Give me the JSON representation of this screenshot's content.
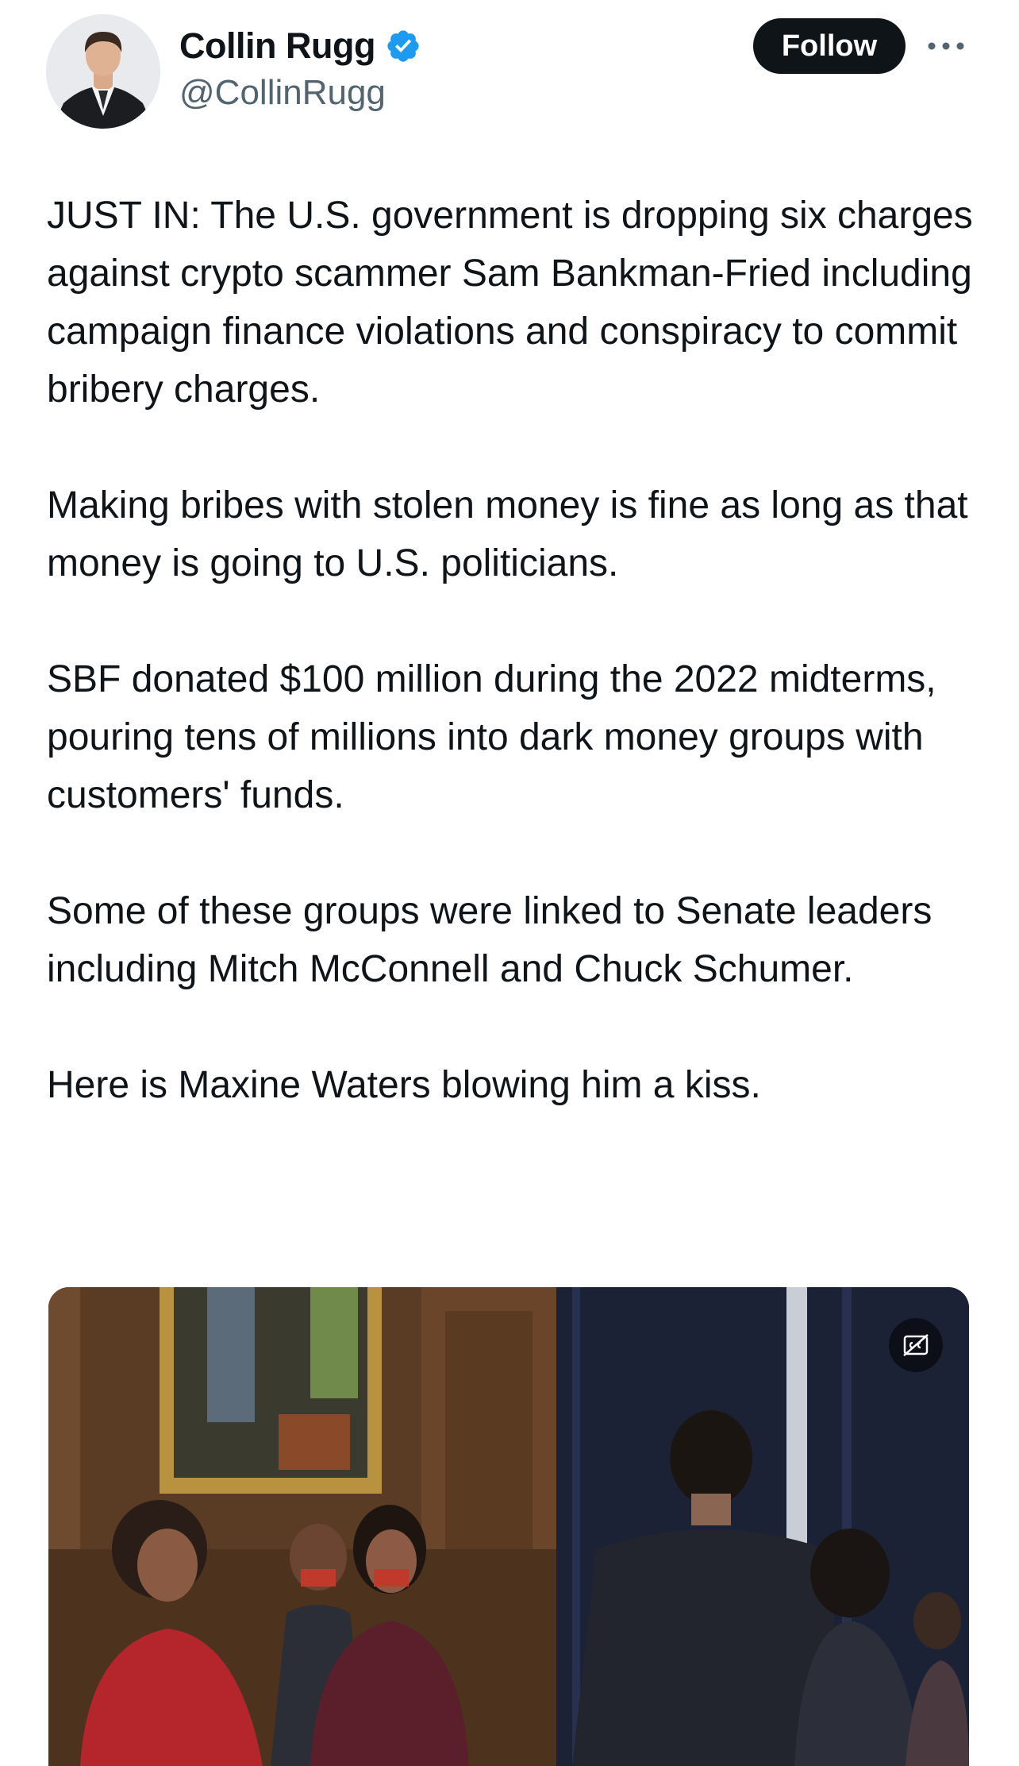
{
  "author": {
    "display_name": "Collin Rugg",
    "handle": "@CollinRugg",
    "verified": true,
    "avatar_icon": "profile-photo"
  },
  "actions": {
    "follow_label": "Follow",
    "more_icon": "more-horizontal-icon"
  },
  "tweet": {
    "paragraphs": [
      "JUST IN: The U.S. government is dropping six charges against crypto scammer Sam Bankman-Fried including campaign finance violations and conspiracy to commit bribery charges.",
      "Making bribes with stolen money is fine as long as that money is going to U.S. politicians.",
      "SBF donated $100 million during the 2022 midterms, pouring tens of millions into dark money groups with customers' funds.",
      "Some of these groups were linked to Senate leaders including Mitch McConnell and Chuck Schumer.",
      "Here is Maxine Waters blowing him a kiss."
    ]
  },
  "media": {
    "type": "video",
    "captions_icon": "captions-off-icon"
  },
  "colors": {
    "text": "#0f1419",
    "secondary_text": "#536471",
    "verified": "#1d9bf0",
    "follow_bg": "#0f1419",
    "follow_text": "#ffffff"
  }
}
